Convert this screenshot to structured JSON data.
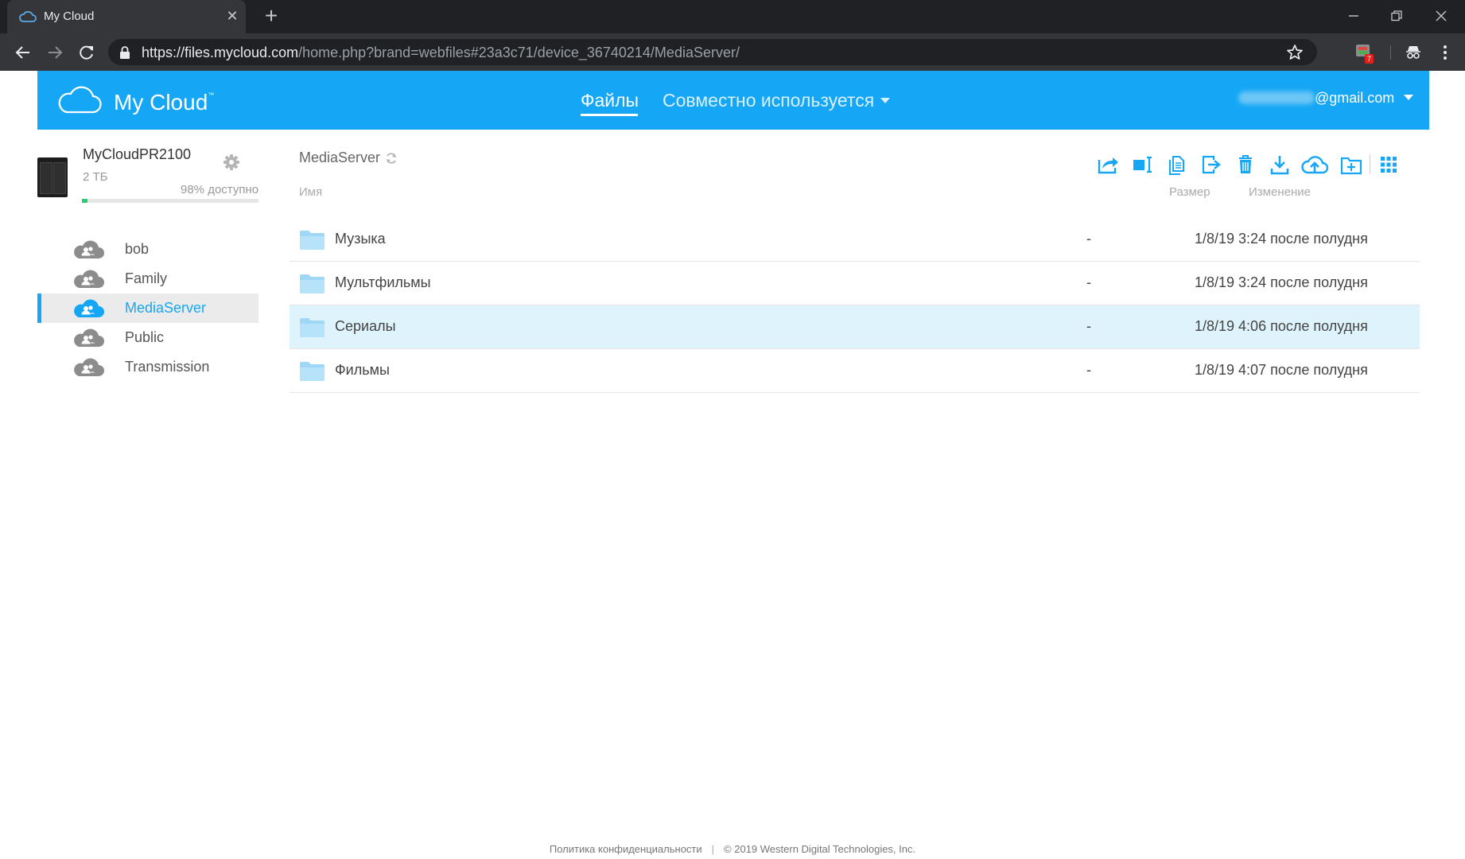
{
  "browser": {
    "tab_title": "My Cloud",
    "url_host": "https://files.mycloud.com",
    "url_path": "/home.php?brand=webfiles#23a3c71/device_36740214/MediaServer/",
    "extension_badge": "7"
  },
  "header": {
    "logo": "My Cloud",
    "logo_tm": "™",
    "nav_files": "Файлы",
    "nav_shared": "Совместно используется",
    "user_email_suffix": "@gmail.com"
  },
  "device": {
    "name": "MyCloudPR2100",
    "capacity": "2 ТБ",
    "available_label": "98% доступно",
    "used_fraction": 0.02
  },
  "sidebar": {
    "items": [
      {
        "label": "bob"
      },
      {
        "label": "Family"
      },
      {
        "label": "MediaServer"
      },
      {
        "label": "Public"
      },
      {
        "label": "Transmission"
      }
    ],
    "active_index": 2
  },
  "main": {
    "breadcrumb": "MediaServer",
    "columns": {
      "name": "Имя",
      "size": "Размер",
      "modified": "Изменение"
    },
    "rows": [
      {
        "name": "Музыка",
        "size": "-",
        "modified": "1/8/19 3:24 после полудня"
      },
      {
        "name": "Мультфильмы",
        "size": "-",
        "modified": "1/8/19 3:24 после полудня"
      },
      {
        "name": "Сериалы",
        "size": "-",
        "modified": "1/8/19 4:06 после полудня"
      },
      {
        "name": "Фильмы",
        "size": "-",
        "modified": "1/8/19 4:07 после полудня"
      }
    ],
    "selected_row": 2
  },
  "footer": {
    "privacy": "Политика конфиденциальности",
    "separator": "|",
    "copyright": "© 2019 Western Digital Technologies, Inc."
  },
  "colors": {
    "accent": "#15a7f5",
    "selected_row": "#dff3fc",
    "folder": "#9fd8f6"
  }
}
